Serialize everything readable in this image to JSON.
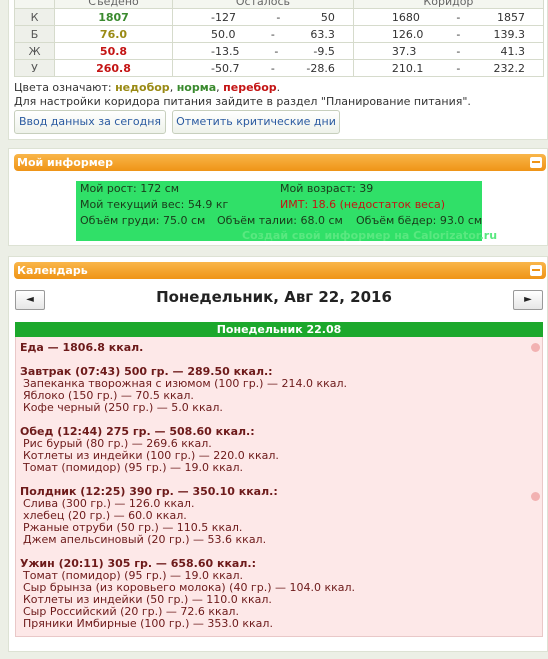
{
  "stats": {
    "headers": [
      "",
      "Съедено",
      "Осталось",
      "Коридор"
    ],
    "rows": [
      {
        "label": "К",
        "eaten": "1807",
        "left_a": "-127",
        "left_b": "50",
        "corr_a": "1680",
        "corr_b": "1857",
        "color": "#3a8a2e"
      },
      {
        "label": "Б",
        "eaten": "76.0",
        "left_a": "50.0",
        "left_b": "63.3",
        "corr_a": "126.0",
        "corr_b": "139.3",
        "color": "#9a8a14"
      },
      {
        "label": "Ж",
        "eaten": "50.8",
        "left_a": "-13.5",
        "left_b": "-9.5",
        "corr_a": "37.3",
        "corr_b": "41.3",
        "color": "#c41414"
      },
      {
        "label": "У",
        "eaten": "260.8",
        "left_a": "-50.7",
        "left_b": "-28.6",
        "corr_a": "210.1",
        "corr_b": "232.2",
        "color": "#c41414"
      }
    ],
    "dash": "-"
  },
  "legend": {
    "prefix": "Цвета означают:",
    "under": "недобор",
    "normal": "норма",
    "over": "перебор",
    "comma": ",",
    "dot": ".",
    "hint": "Для настройки коридора питания зайдите в раздел \"Планирование питания\"."
  },
  "buttons": {
    "today": "Ввод данных за сегодня",
    "critical": "Отметить критические дни"
  },
  "informer": {
    "title": "Мой информер",
    "height": "Мой рост: 172 см",
    "age": "Мой возраст: 39",
    "weight": "Мой текущий вес: 54.9 кг",
    "bmi": "ИМТ: 18.6 (недостаток веса)",
    "chest": "Объём груди: 75.0 см",
    "waist": "Объём талии: 68.0 см",
    "hips": "Объём бёдер: 93.0 см",
    "link": "Создай свой информер на Calorizator.ru"
  },
  "calendar": {
    "title": "Календарь",
    "prev": "◄",
    "next": "►",
    "date_title": "Понедельник, Авг 22, 2016",
    "day_header": "Понедельник 22.08",
    "total": "Еда — 1806.8 ккал.",
    "meals": [
      {
        "title": "Завтрак (07:43) 500 гр. — 289.50 ккал.:",
        "items": [
          "Запеканка творожная с изюмом (100 гр.) — 214.0 ккал.",
          "Яблоко (150 гр.) — 70.5 ккал.",
          "Кофе черный (250 гр.) — 5.0 ккал."
        ]
      },
      {
        "title": "Обед (12:44) 275 гр. — 508.60 ккал.:",
        "items": [
          "Рис бурый (80 гр.) — 269.6 ккал.",
          "Котлеты из индейки (100 гр.) — 220.0 ккал.",
          "Томат (помидор) (95 гр.) — 19.0 ккал."
        ]
      },
      {
        "title": "Полдник (12:25) 390 гр. — 350.10 ккал.:",
        "items": [
          "Слива (300 гр.) — 126.0 ккал.",
          "хлебец (20 гр.) — 60.0 ккал.",
          "Ржаные отруби (50 гр.) — 110.5 ккал.",
          "Джем апельсиновый (20 гр.) — 53.6 ккал."
        ]
      },
      {
        "title": "Ужин (20:11) 305 гр. — 658.60 ккал.:",
        "items": [
          "Томат (помидор) (95 гр.) — 19.0 ккал.",
          "Сыр брынза (из коровьего молока) (40 гр.) — 104.0 ккал.",
          "Котлеты из индейки (50 гр.) — 110.0 ккал.",
          "Сыр Российский (20 гр.) — 72.6 ккал.",
          "Пряники Имбирные (100 гр.) — 353.0 ккал."
        ]
      }
    ]
  },
  "colors": {
    "accent": "#ef9416",
    "green": "#1ca82c",
    "informer_bg": "#30e068"
  },
  "icons": {
    "minimize": "minus-icon",
    "apple": "apple-icon"
  }
}
